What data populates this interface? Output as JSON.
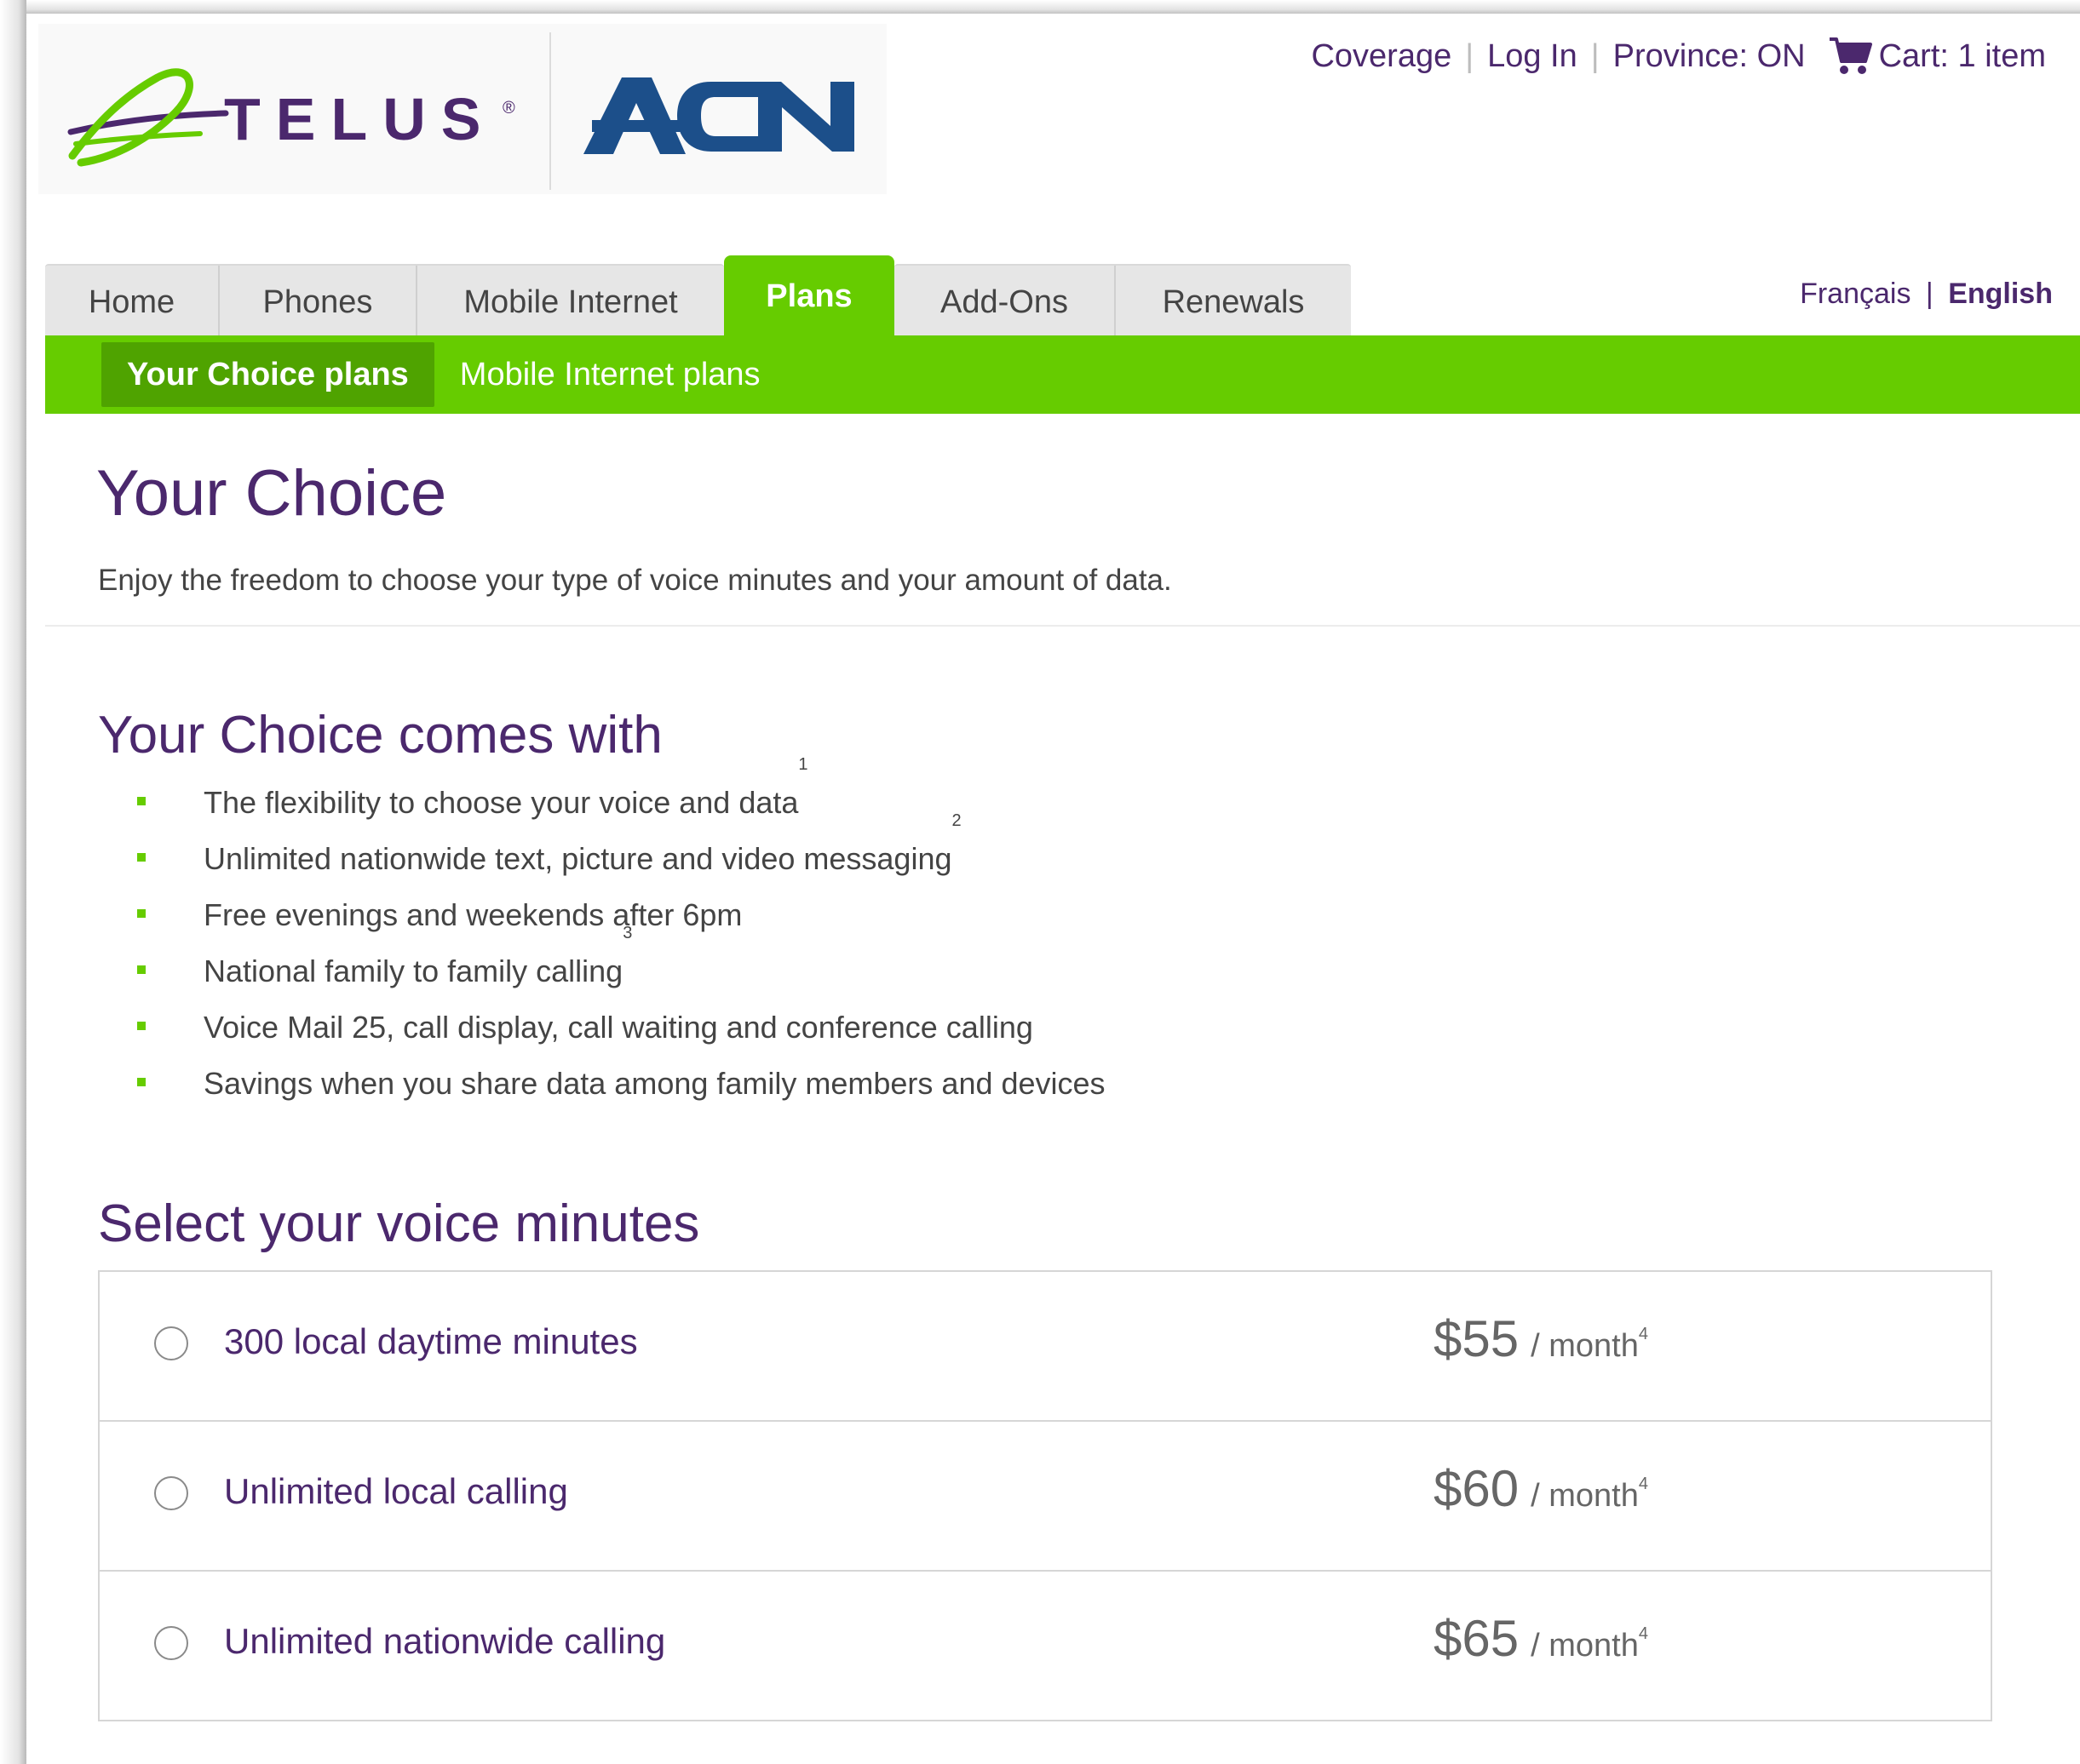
{
  "brand": {
    "telus_wordmark": "TELUS",
    "telus_registered": "®",
    "partner_wordmark": "ACN",
    "colors": {
      "purple": "#4b286d",
      "green": "#66cc00",
      "green_dark": "#4fa300"
    }
  },
  "utility_nav": {
    "coverage": "Coverage",
    "login": "Log In",
    "province": "Province: ON",
    "cart_prefix": "Cart:",
    "cart_count": "1 item",
    "separator": "|"
  },
  "language": {
    "french": "Français",
    "english": "English",
    "separator": "|"
  },
  "main_nav": {
    "tabs": [
      {
        "label": "Home"
      },
      {
        "label": "Phones"
      },
      {
        "label": "Mobile Internet"
      },
      {
        "label": "Plans"
      },
      {
        "label": "Add-Ons"
      },
      {
        "label": "Renewals"
      }
    ],
    "active": "Plans"
  },
  "sub_nav": {
    "items": [
      {
        "label": "Your Choice plans"
      },
      {
        "label": "Mobile Internet plans"
      }
    ],
    "active": "Your Choice plans"
  },
  "page": {
    "title": "Your Choice",
    "intro": "Enjoy the freedom to choose your type of voice minutes and your amount of data."
  },
  "features": {
    "heading": "Your Choice comes with",
    "items": [
      {
        "text": "The flexibility to choose your voice and data",
        "note": "1"
      },
      {
        "text": "Unlimited nationwide text, picture and video messaging",
        "note": "2"
      },
      {
        "text": "Free evenings and weekends after 6pm",
        "note": ""
      },
      {
        "text": "National family to family calling",
        "note": "3"
      },
      {
        "text": "Voice Mail 25, call display, call waiting and conference calling",
        "note": ""
      },
      {
        "text": "Savings when you share data among family members and devices",
        "note": ""
      }
    ]
  },
  "voice_minutes": {
    "heading": "Select your voice minutes",
    "options": [
      {
        "label": "300 local daytime minutes",
        "price": "$55",
        "period": "/ month",
        "note": "4",
        "selected": false
      },
      {
        "label": "Unlimited local calling",
        "price": "$60",
        "period": "/ month",
        "note": "4",
        "selected": false
      },
      {
        "label": "Unlimited nationwide calling",
        "price": "$65",
        "period": "/ month",
        "note": "4",
        "selected": false
      }
    ]
  }
}
